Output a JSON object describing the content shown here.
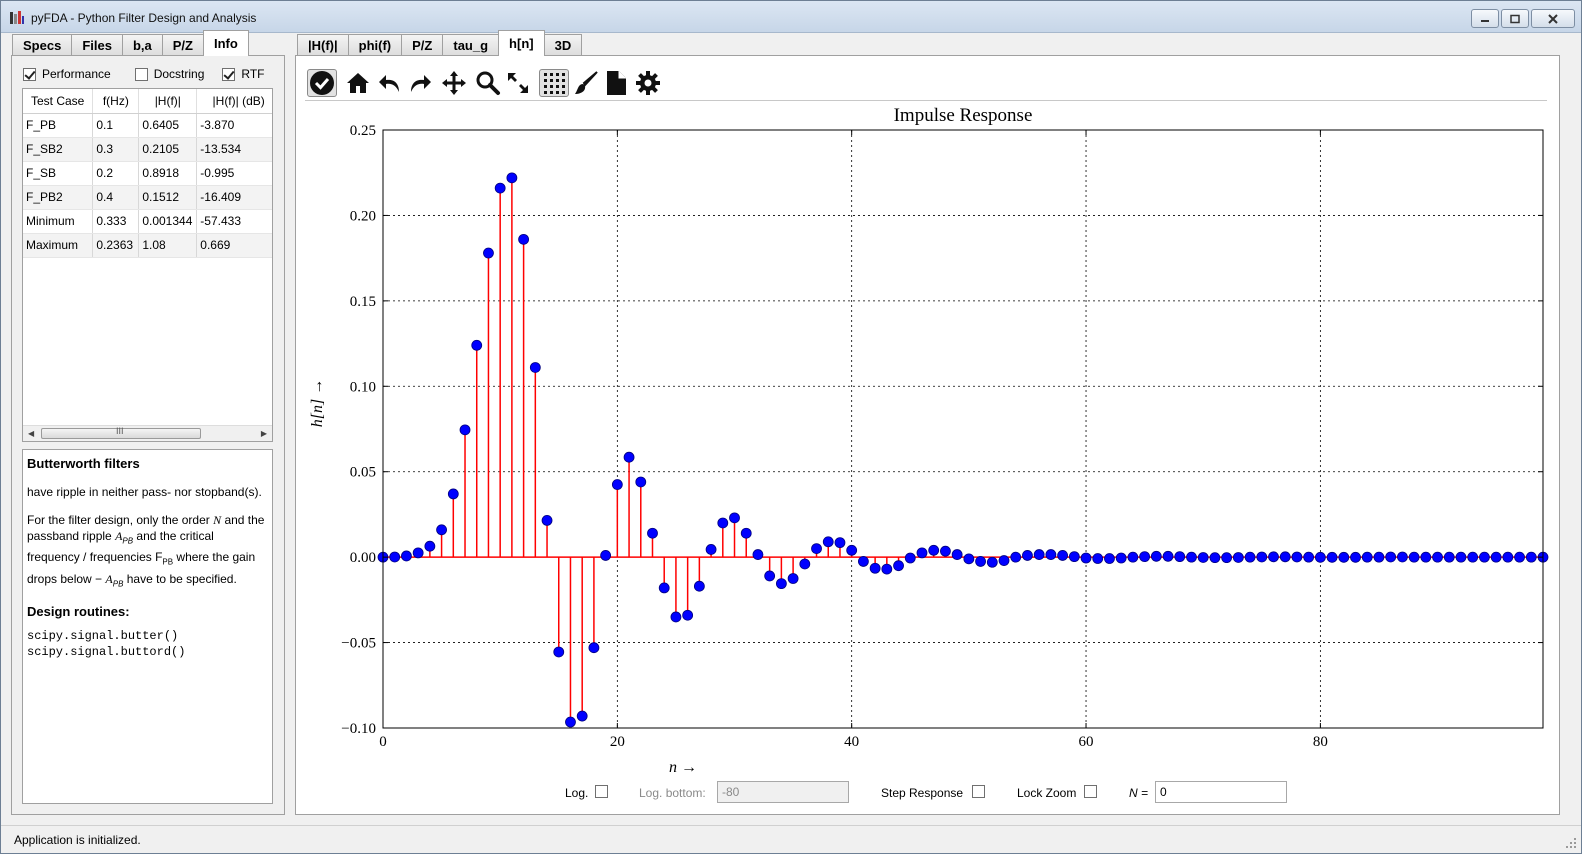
{
  "window": {
    "title": "pyFDA - Python Filter Design and Analysis",
    "icon": "pyfda-icon",
    "buttons": [
      "minimize",
      "maximize",
      "close"
    ]
  },
  "left_tabs": [
    "Specs",
    "Files",
    "b,a",
    "P/Z",
    "Info"
  ],
  "left_active_tab": "Info",
  "info": {
    "checkboxes": [
      {
        "label": "Performance",
        "checked": true
      },
      {
        "label": "Docstring",
        "checked": false
      },
      {
        "label": "RTF",
        "checked": true
      }
    ],
    "table": {
      "headers": [
        "Test Case",
        "f(Hz)",
        "|H(f)|",
        "|H(f)| (dB)"
      ],
      "rows": [
        [
          "F_PB",
          "0.1",
          "0.6405",
          "-3.870"
        ],
        [
          "F_SB2",
          "0.3",
          "0.2105",
          "-13.534"
        ],
        [
          "F_SB",
          "0.2",
          "0.8918",
          "-0.995"
        ],
        [
          "F_PB2",
          "0.4",
          "0.1512",
          "-16.409"
        ],
        [
          "Minimum",
          "0.333",
          "0.001344",
          "-57.433"
        ],
        [
          "Maximum",
          "0.2363",
          "1.08",
          "0.669"
        ]
      ]
    },
    "scrollbar_grip": "III",
    "doc": {
      "title": "Butterworth filters",
      "para1": "have ripple in neither pass- nor stopband(s).",
      "para2_a": "For the filter design, only the order ",
      "para2_N": "N",
      "para2_b": " and the passband ripple ",
      "para2_A": "A",
      "para2_PB": "PB",
      "para2_c": " and the critical frequency / frequencies F",
      "para2_c_sub": "PB",
      "para2_d": " where the gain drops below − ",
      "para2_A2": "A",
      "para2_PB2": "PB",
      "para2_e": " have to be specified.",
      "routines_title": "Design routines:",
      "routine1": "scipy.signal.butter()",
      "routine2": "scipy.signal.buttord()"
    }
  },
  "right_tabs": [
    "|H(f)|",
    "phi(f)",
    "P/Z",
    "tau_g",
    "h[n]",
    "3D"
  ],
  "right_active_tab": "h[n]",
  "toolbar_icons": [
    "check-icon",
    "home-icon",
    "undo-icon",
    "redo-icon",
    "pan-icon",
    "zoom-icon",
    "full-view-icon",
    "grid-icon",
    "brush-icon",
    "save-icon",
    "settings-icon"
  ],
  "chart_data": {
    "type": "stem",
    "title": "Impulse Response",
    "xlabel": "n  →",
    "ylabel": "h[n]  →",
    "xlim": [
      0,
      99
    ],
    "ylim": [
      -0.1,
      0.25
    ],
    "xticks": [
      "0",
      "20",
      "40",
      "60",
      "80"
    ],
    "yticks": [
      "0.25",
      "0.20",
      "0.15",
      "0.10",
      "0.05",
      "0.00",
      "−0.05",
      "−0.10"
    ],
    "grid": true,
    "stem_color": "#ff0000",
    "marker_color": "#0000ff",
    "x": [
      0,
      1,
      2,
      3,
      4,
      5,
      6,
      7,
      8,
      9,
      10,
      11,
      12,
      13,
      14,
      15,
      16,
      17,
      18,
      19,
      20,
      21,
      22,
      23,
      24,
      25,
      26,
      27,
      28,
      29,
      30,
      31,
      32,
      33,
      34,
      35,
      36,
      37,
      38,
      39,
      40,
      41,
      42,
      43,
      44,
      45,
      46,
      47,
      48,
      49,
      50,
      51,
      52,
      53,
      54,
      55,
      56,
      57,
      58,
      59,
      60,
      61,
      62,
      63,
      64,
      65,
      66,
      67,
      68,
      69,
      70,
      71,
      72,
      73,
      74,
      75,
      76,
      77,
      78,
      79,
      80,
      81,
      82,
      83,
      84,
      85,
      86,
      87,
      88,
      89,
      90,
      91,
      92,
      93,
      94,
      95,
      96,
      97,
      98,
      99
    ],
    "values": [
      0.0,
      0.0001,
      0.0007,
      0.0025,
      0.0064,
      0.016,
      0.037,
      0.0745,
      0.124,
      0.178,
      0.216,
      0.222,
      0.186,
      0.111,
      0.0215,
      -0.0555,
      -0.0965,
      -0.093,
      -0.053,
      0.001,
      0.0425,
      0.0585,
      0.044,
      0.014,
      -0.018,
      -0.035,
      -0.034,
      -0.017,
      0.0045,
      0.02,
      0.023,
      0.014,
      0.0015,
      -0.011,
      -0.0155,
      -0.0125,
      -0.004,
      0.005,
      0.009,
      0.0085,
      0.004,
      -0.0025,
      -0.0065,
      -0.007,
      -0.005,
      -0.0005,
      0.0025,
      0.004,
      0.0035,
      0.0015,
      -0.001,
      -0.0025,
      -0.003,
      -0.002,
      0.0,
      0.001,
      0.0015,
      0.0015,
      0.001,
      0.0003,
      -0.0005,
      -0.0008,
      -0.0008,
      -0.0005,
      0.0,
      0.0003,
      0.0005,
      0.0005,
      0.0003,
      0.0,
      -0.0002,
      -0.0003,
      -0.0003,
      -0.0002,
      0.0,
      0.0001,
      0.0002,
      0.0002,
      0.0001,
      0.0,
      -0.0001,
      -0.0001,
      -0.0001,
      -0.0001,
      0.0,
      0.0,
      0.0001,
      0.0001,
      0.0,
      0.0,
      0.0,
      0.0,
      0.0,
      0.0,
      0.0,
      0.0,
      0.0,
      0.0,
      0.0,
      0.0
    ]
  },
  "controls": {
    "log_label": "Log.",
    "log_bottom_label": "Log. bottom:",
    "log_bottom_value": "-80",
    "step_label": "Step Response",
    "lock_label": "Lock Zoom",
    "n_label": "N =",
    "n_value": "0"
  },
  "status": "Application is initialized."
}
